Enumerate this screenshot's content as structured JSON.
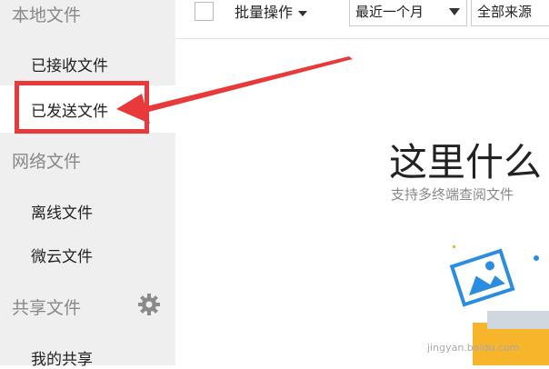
{
  "sidebar": {
    "local_section": "本地文件",
    "items_local": [
      {
        "label": "已接收文件"
      },
      {
        "label": "已发送文件"
      }
    ],
    "network_section": "网络文件",
    "items_network": [
      {
        "label": "离线文件"
      },
      {
        "label": "微云文件"
      }
    ],
    "share_section": "共享文件",
    "items_share": [
      {
        "label": "我的共享"
      }
    ]
  },
  "toolbar": {
    "batch_label": "批量操作",
    "time_filter": "最近一个月",
    "source_filter": "全部来源"
  },
  "empty_state": {
    "title": "这里什么",
    "subtitle": "支持多终端查阅文件"
  },
  "watermark": "jingyan.baidu.com",
  "colors": {
    "annotation_red": "#e83a3a",
    "sidebar_bg": "#efefef"
  }
}
